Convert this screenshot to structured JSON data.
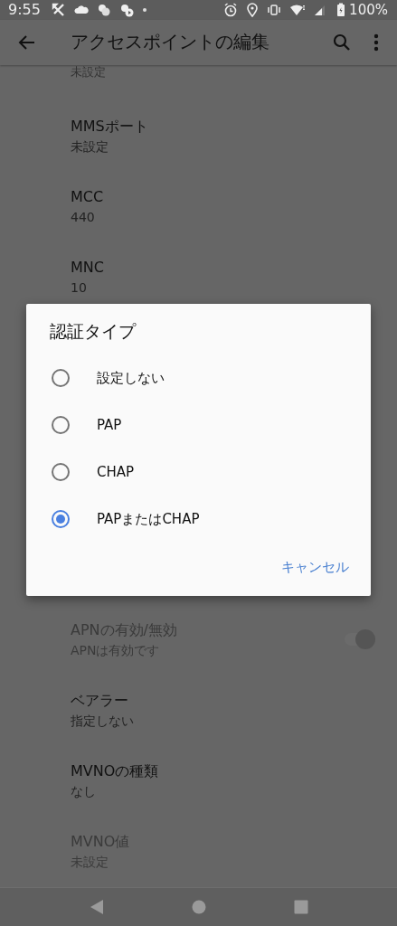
{
  "status_bar": {
    "time": "9:55",
    "battery": "100%"
  },
  "app_bar": {
    "title": "アクセスポイントの編集"
  },
  "cut_row": {
    "summary": "未設定"
  },
  "rows_above": [
    {
      "title": "MMSポート",
      "summary": "未設定",
      "disabled": false
    },
    {
      "title": "MCC",
      "summary": "440",
      "disabled": false
    },
    {
      "title": "MNC",
      "summary": "10",
      "disabled": false
    }
  ],
  "dialog": {
    "title": "認証タイプ",
    "options": [
      {
        "label": "設定しない",
        "selected": false
      },
      {
        "label": "PAP",
        "selected": false
      },
      {
        "label": "CHAP",
        "selected": false
      },
      {
        "label": "PAPまたはCHAP",
        "selected": true
      }
    ],
    "cancel": "キャンセル"
  },
  "rows_below": [
    {
      "kind": "toggle",
      "title": "APNの有効/無効",
      "summary": "APNは有効です",
      "disabled": true,
      "on": true
    },
    {
      "kind": "text",
      "title": "ベアラー",
      "summary": "指定しない",
      "disabled": false
    },
    {
      "kind": "text",
      "title": "MVNOの種類",
      "summary": "なし",
      "disabled": false
    },
    {
      "kind": "text",
      "title": "MVNO値",
      "summary": "未設定",
      "disabled": true
    }
  ]
}
